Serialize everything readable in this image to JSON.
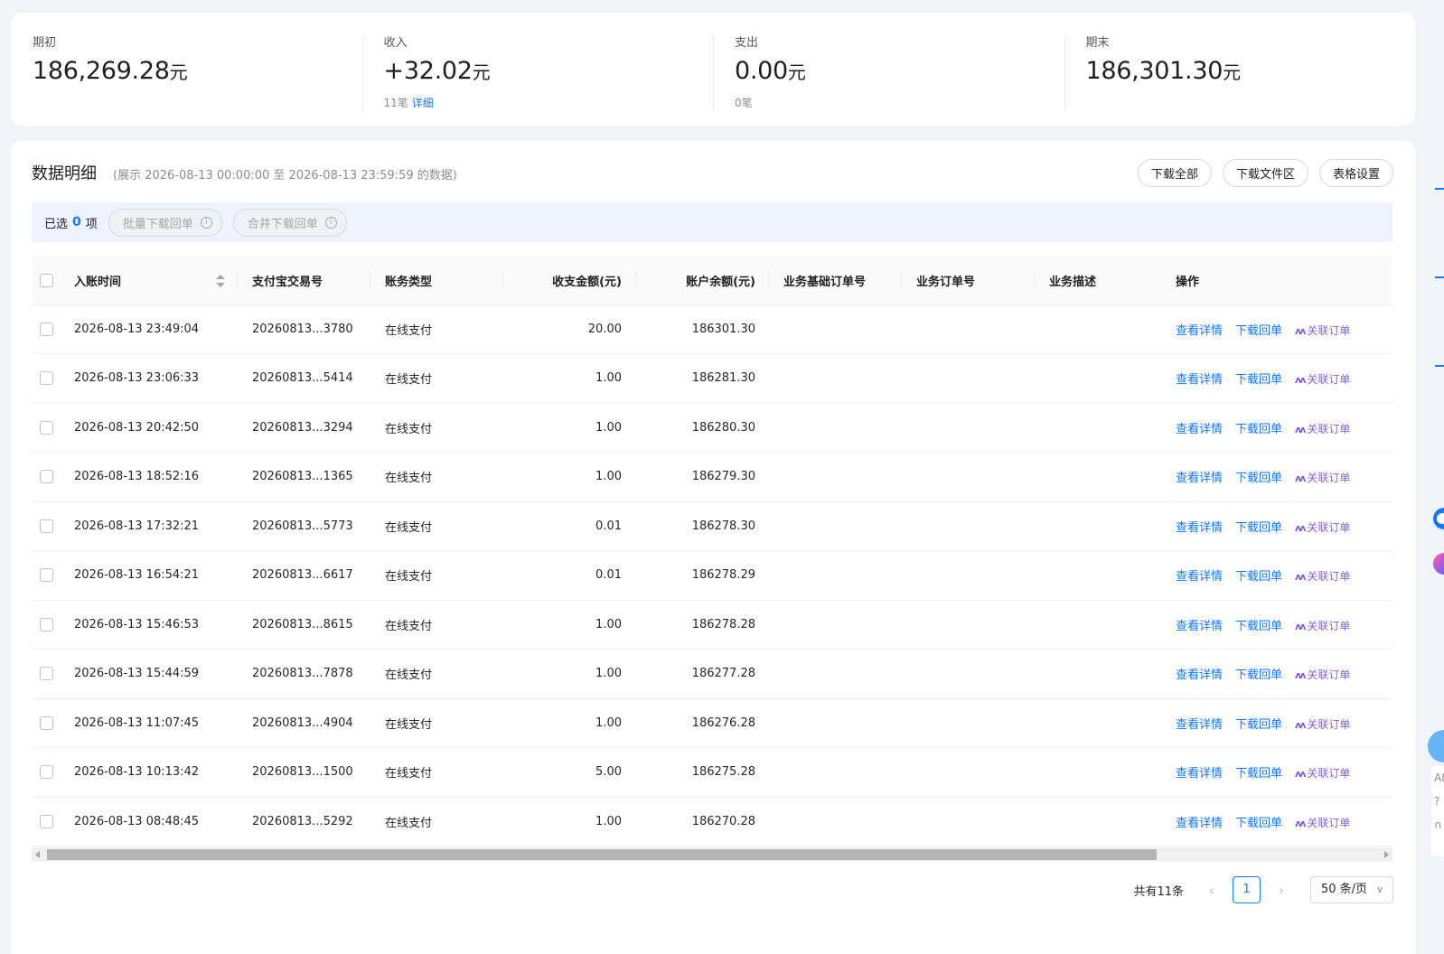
{
  "summary": [
    {
      "label": "期初",
      "value": "186,269.28",
      "unit": "元",
      "sub_count": "",
      "sub_link": ""
    },
    {
      "label": "收入",
      "value": "+32.02",
      "unit": "元",
      "sub_count": "11笔",
      "sub_link": "详细"
    },
    {
      "label": "支出",
      "value": "0.00",
      "unit": "元",
      "sub_count": "0笔",
      "sub_link": ""
    },
    {
      "label": "期末",
      "value": "186,301.30",
      "unit": "元",
      "sub_count": "",
      "sub_link": ""
    }
  ],
  "panel": {
    "title": "数据明细",
    "range": "(展示 2026-08-13 00:00:00 至 2026-08-13 23:59:59 的数据)",
    "actions": {
      "download_all": "下载全部",
      "download_files": "下载文件区",
      "table_settings": "表格设置"
    }
  },
  "selection": {
    "prefix": "已选",
    "count": "0",
    "suffix": "项",
    "batch_download": "批量下载回单",
    "merge_download": "合并下载回单",
    "info_glyph": "i"
  },
  "table": {
    "headers": {
      "time": "入账时间",
      "trade_no": "支付宝交易号",
      "type": "账务类型",
      "amount": "收支金额(元)",
      "balance": "账户余额(元)",
      "base_order": "业务基础订单号",
      "order": "业务订单号",
      "desc": "业务描述",
      "ops": "操作"
    },
    "op_labels": {
      "detail": "查看详情",
      "receipt": "下载回单",
      "link_order": "关联订单",
      "ai_glyph": "AI"
    },
    "rows": [
      {
        "time": "2026-08-13 23:49:04",
        "trade_no": "20260813...3780",
        "type": "在线支付",
        "amount": "20.00",
        "balance": "186301.30"
      },
      {
        "time": "2026-08-13 23:06:33",
        "trade_no": "20260813...5414",
        "type": "在线支付",
        "amount": "1.00",
        "balance": "186281.30"
      },
      {
        "time": "2026-08-13 20:42:50",
        "trade_no": "20260813...3294",
        "type": "在线支付",
        "amount": "1.00",
        "balance": "186280.30"
      },
      {
        "time": "2026-08-13 18:52:16",
        "trade_no": "20260813...1365",
        "type": "在线支付",
        "amount": "1.00",
        "balance": "186279.30"
      },
      {
        "time": "2026-08-13 17:32:21",
        "trade_no": "20260813...5773",
        "type": "在线支付",
        "amount": "0.01",
        "balance": "186278.30"
      },
      {
        "time": "2026-08-13 16:54:21",
        "trade_no": "20260813...6617",
        "type": "在线支付",
        "amount": "0.01",
        "balance": "186278.29"
      },
      {
        "time": "2026-08-13 15:46:53",
        "trade_no": "20260813...8615",
        "type": "在线支付",
        "amount": "1.00",
        "balance": "186278.28"
      },
      {
        "time": "2026-08-13 15:44:59",
        "trade_no": "20260813...7878",
        "type": "在线支付",
        "amount": "1.00",
        "balance": "186277.28"
      },
      {
        "time": "2026-08-13 11:07:45",
        "trade_no": "20260813...4904",
        "type": "在线支付",
        "amount": "1.00",
        "balance": "186276.28"
      },
      {
        "time": "2026-08-13 10:13:42",
        "trade_no": "20260813...1500",
        "type": "在线支付",
        "amount": "5.00",
        "balance": "186275.28"
      },
      {
        "time": "2026-08-13 08:48:45",
        "trade_no": "20260813...5292",
        "type": "在线支付",
        "amount": "1.00",
        "balance": "186270.28"
      }
    ]
  },
  "pagination": {
    "total": "共有11条",
    "current_page": "1",
    "page_size": "50 条/页",
    "prev_glyph": "‹",
    "next_glyph": "›",
    "chevron_glyph": "∨"
  },
  "side_widgets": {
    "ai_label": "AI",
    "help_glyph": "?",
    "service_glyph": "∩"
  },
  "icons": {
    "sort": "sort-icon",
    "info": "info-icon",
    "ai": "ai-sparkle-icon",
    "prev": "chevron-left-icon",
    "next": "chevron-right-icon",
    "page_size_dropdown": "chevron-down-icon"
  },
  "colors": {
    "accent": "#1677ff",
    "ai_purple": "#8a63d2",
    "background": "#f1f4f9"
  }
}
